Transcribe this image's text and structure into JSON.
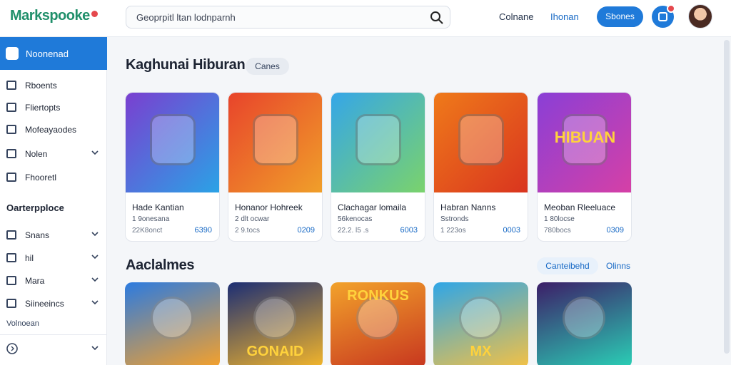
{
  "header": {
    "logo": "Markspooke",
    "search": {
      "value": "Geoprpitl ltan lodnparnh"
    },
    "nav": [
      "Colnane",
      "Ihonan"
    ],
    "cta": "Sbones"
  },
  "sidebar": {
    "active": "Noonenad",
    "items": [
      "Rboents",
      "Fliertopts",
      "Mofeayaodes",
      "Nolen",
      "Fhooretl"
    ],
    "heading": "Oarterpploce",
    "items2": [
      "Snans",
      "hil",
      "Mara",
      "Siineeincs"
    ],
    "note": "Volnoean"
  },
  "section1": {
    "title": "Kaghunai Hiburan",
    "chip": "Canes"
  },
  "cards": [
    {
      "name": "Hade Kantian",
      "sub": "1 9onesana",
      "meta": "22K8onct",
      "price": "6390",
      "icon": "puzzle-icon",
      "colors": [
        "#7a3fd0",
        "#2aa3e6"
      ]
    },
    {
      "name": "Honanor Hohreek",
      "sub": "2 dlt ocwar",
      "meta": "2 9.tocs",
      "price": "0209",
      "icon": "controller-icon",
      "colors": [
        "#e8442b",
        "#f0a02a"
      ]
    },
    {
      "name": "Clachagar lomaila",
      "sub": "56kenocas",
      "meta": "22.2. l5 .s",
      "price": "6003",
      "icon": "tablet-icon",
      "colors": [
        "#35a6e8",
        "#7bd36b"
      ]
    },
    {
      "name": "Habran Nanns",
      "sub": "Sstronds",
      "meta": "1 223os",
      "price": "0003",
      "icon": "camera-icon",
      "colors": [
        "#ef7a1a",
        "#d9341f"
      ]
    },
    {
      "name": "Meoban Rleeluace",
      "sub": "1 80locse",
      "meta": "780bocs",
      "price": "0309",
      "icon": "gem-icon",
      "colors": [
        "#8a3fd6",
        "#d640a6"
      ],
      "art_text": "HIBUAN"
    }
  ],
  "section2": {
    "title": "Aaclalmes",
    "chip": "Canteibehd",
    "link": "Olinns"
  },
  "cards2": [
    {
      "icon": "boy-icon",
      "colors": [
        "#2c7be0",
        "#f6a12a"
      ]
    },
    {
      "icon": "cat-icon",
      "colors": [
        "#1c2e74",
        "#f4b62a"
      ],
      "art_text": "GONAID"
    },
    {
      "icon": "hero-icon",
      "colors": [
        "#f2a22b",
        "#c7361f"
      ],
      "art_text": "RONKUS"
    },
    {
      "icon": "bear-icon",
      "colors": [
        "#2fa6e7",
        "#f4c144"
      ],
      "art_text": "MX"
    },
    {
      "icon": "ninja-icon",
      "colors": [
        "#3c1e68",
        "#2ad0b6"
      ]
    }
  ]
}
